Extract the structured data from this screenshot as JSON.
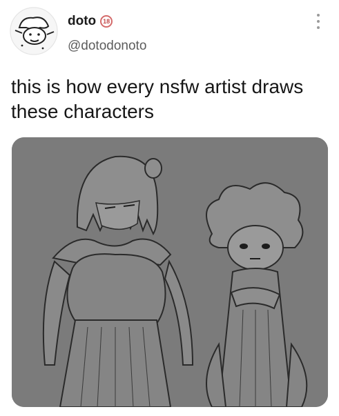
{
  "author": {
    "display_name": "doto",
    "badge": "18",
    "handle": "@dotodonoto"
  },
  "post": {
    "text": "this is how every nsfw artist draws these characters"
  },
  "colors": {
    "badge": "#d46a6a",
    "media_bg": "#7b7b7b",
    "handle": "#5c5c5c"
  },
  "icons": {
    "more": "more-vertical-icon",
    "avatar": "doodle-avatar"
  }
}
